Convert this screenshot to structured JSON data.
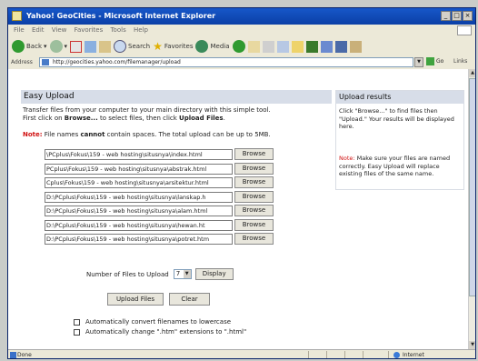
{
  "window": {
    "title": "Yahoo! GeoCities - Microsoft Internet Explorer"
  },
  "menu": [
    "File",
    "Edit",
    "View",
    "Favorites",
    "Tools",
    "Help"
  ],
  "toolbar": {
    "back": "Back",
    "search": "Search",
    "favorites": "Favorites",
    "media": "Media"
  },
  "address": {
    "label": "Address",
    "url": "http://geocities.yahoo.com/filemanager/upload",
    "go": "Go",
    "links": "Links"
  },
  "upload": {
    "heading": "Easy Upload",
    "intro_line1": "Transfer files from your computer to your main directory with this simple tool.",
    "intro_line2_pre": "First click on ",
    "intro_browse": "Browse...",
    "intro_line2_mid": " to select files, then click ",
    "intro_upload": "Upload Files",
    "intro_line2_end": ".",
    "note_label": "Note:",
    "note_pre": " File names ",
    "note_cannot": "cannot",
    "note_post": " contain spaces. The total upload can be up to 5MB.",
    "browse_label": "Browse",
    "files": [
      "\\PCplus\\Fokus\\159 - web hosting\\situsnya\\index.html",
      "PCplus\\Fokus\\159 - web hosting\\situsnya\\abstrak.html",
      "Cplus\\Fokus\\159 - web hosting\\situsnya\\arsitektur.html",
      "D:\\PCplus\\Fokus\\159 - web hosting\\situsnya\\lanskap.h",
      "D:\\PCplus\\Fokus\\159 - web hosting\\situsnya\\alam.html",
      "D:\\PCplus\\Fokus\\159 - web hosting\\situsnya\\hewan.ht",
      "D:\\PCplus\\Fokus\\159 - web hosting\\situsnya\\potret.htm"
    ],
    "num_files_label": "Number of Files to Upload",
    "num_files_value": "7",
    "display_label": "Display",
    "upload_files_label": "Upload Files",
    "clear_label": "Clear",
    "opt_lowercase": "Automatically convert filenames to lowercase",
    "opt_htm": "Automatically change \".htm\" extensions to \".html\""
  },
  "results": {
    "heading": "Upload results",
    "text": "Click \"Browse...\" to find files then \"Upload.\" Your results will be displayed here.",
    "note_label": "Note:",
    "note_text": " Make sure your files are named correctly. Easy Upload will replace existing files of the same name."
  },
  "status": {
    "text": "Done",
    "zone": "Internet"
  }
}
